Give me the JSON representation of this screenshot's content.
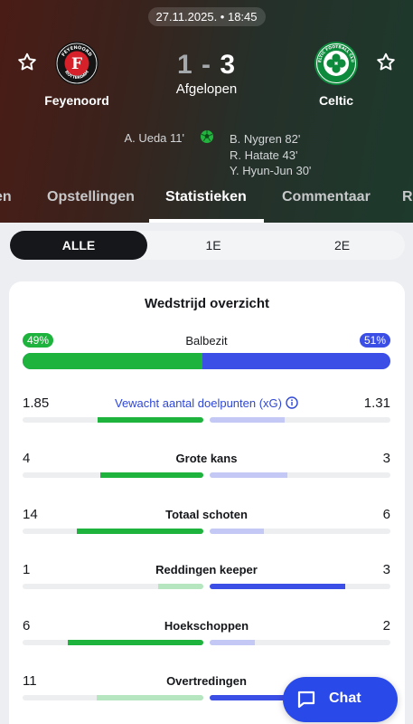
{
  "match": {
    "datetime": "27.11.2025. • 18:45",
    "home_team": "Feyenoord",
    "away_team": "Celtic",
    "home_score": "1",
    "separator": "-",
    "away_score": "3",
    "status": "Afgelopen",
    "home_scorers": [
      "A. Ueda 11'"
    ],
    "away_scorers": [
      "B. Nygren 82'",
      "R. Hatate 43'",
      "Y. Hyun-Jun 30'"
    ],
    "home_crest_text_top": "FEYENOORD",
    "home_crest_text_bottom": "ROTTERDAM",
    "home_crest_letter": "F",
    "away_crest_text": "CELTIC FOOTBALL CLUB",
    "away_crest_year": "1888"
  },
  "tabs": [
    "en",
    "Opstellingen",
    "Statistieken",
    "Commentaar",
    "Ra"
  ],
  "active_tab": "Statistieken",
  "periods": [
    "ALLE",
    "1E",
    "2E"
  ],
  "active_period": "ALLE",
  "overview": {
    "title": "Wedstrijd overzicht",
    "possession": {
      "label": "Balbezit",
      "home_label": "49%",
      "away_label": "51%",
      "home": 0.49
    },
    "stats": [
      {
        "label": "Vewacht aantal doelpunten (xG)",
        "home": "1.85",
        "away": "1.31",
        "home_fill": 0.585,
        "away_fill": 0.415,
        "home_lead": true,
        "link": true
      },
      {
        "label": "Grote kans",
        "home": "4",
        "away": "3",
        "home_fill": 0.57,
        "away_fill": 0.43,
        "home_lead": true
      },
      {
        "label": "Totaal schoten",
        "home": "14",
        "away": "6",
        "home_fill": 0.7,
        "away_fill": 0.3,
        "home_lead": true
      },
      {
        "label": "Reddingen keeper",
        "home": "1",
        "away": "3",
        "home_fill": 0.25,
        "away_fill": 0.75,
        "home_lead": false
      },
      {
        "label": "Hoekschoppen",
        "home": "6",
        "away": "2",
        "home_fill": 0.75,
        "away_fill": 0.25,
        "home_lead": true
      },
      {
        "label": "Overtredingen",
        "home": "11",
        "away": "",
        "home_fill": 0.59,
        "away_fill": 0.41,
        "home_lead": false
      }
    ]
  },
  "chat": {
    "label": "Chat"
  },
  "colors": {
    "home_strong": "#1db33c",
    "home_weak": "#b5e6c0",
    "away_strong": "#3b4ee6",
    "away_weak": "#c3c9f4",
    "accent": "#2a49e9"
  },
  "icons": [
    "star-outline-icon",
    "football-icon",
    "info-icon",
    "chat-bubble-icon"
  ]
}
